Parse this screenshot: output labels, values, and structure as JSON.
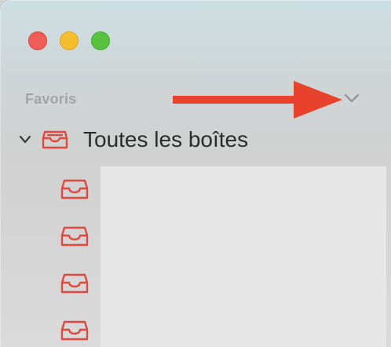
{
  "window": {
    "controls": [
      "close-button",
      "minimize-button",
      "zoom-button"
    ],
    "colors": {
      "close": "#ee5e57",
      "minimize": "#f5be2f",
      "zoom": "#58c33f",
      "accent_red": "#e2483b",
      "annotation_arrow": "#e8412c"
    }
  },
  "sidebar": {
    "section_label": "Favoris",
    "section_chevron_icon": "chevron-down-icon",
    "mailboxes": {
      "title": "Toutes les boîtes",
      "expand_icon": "chevron-down-icon",
      "icon": "tray-icon",
      "items": [
        {
          "icon": "tray-icon"
        },
        {
          "icon": "tray-icon"
        },
        {
          "icon": "tray-icon"
        },
        {
          "icon": "tray-icon"
        }
      ]
    }
  },
  "annotation": {
    "arrow_direction": "right",
    "points_to": "section_chevron_icon"
  }
}
